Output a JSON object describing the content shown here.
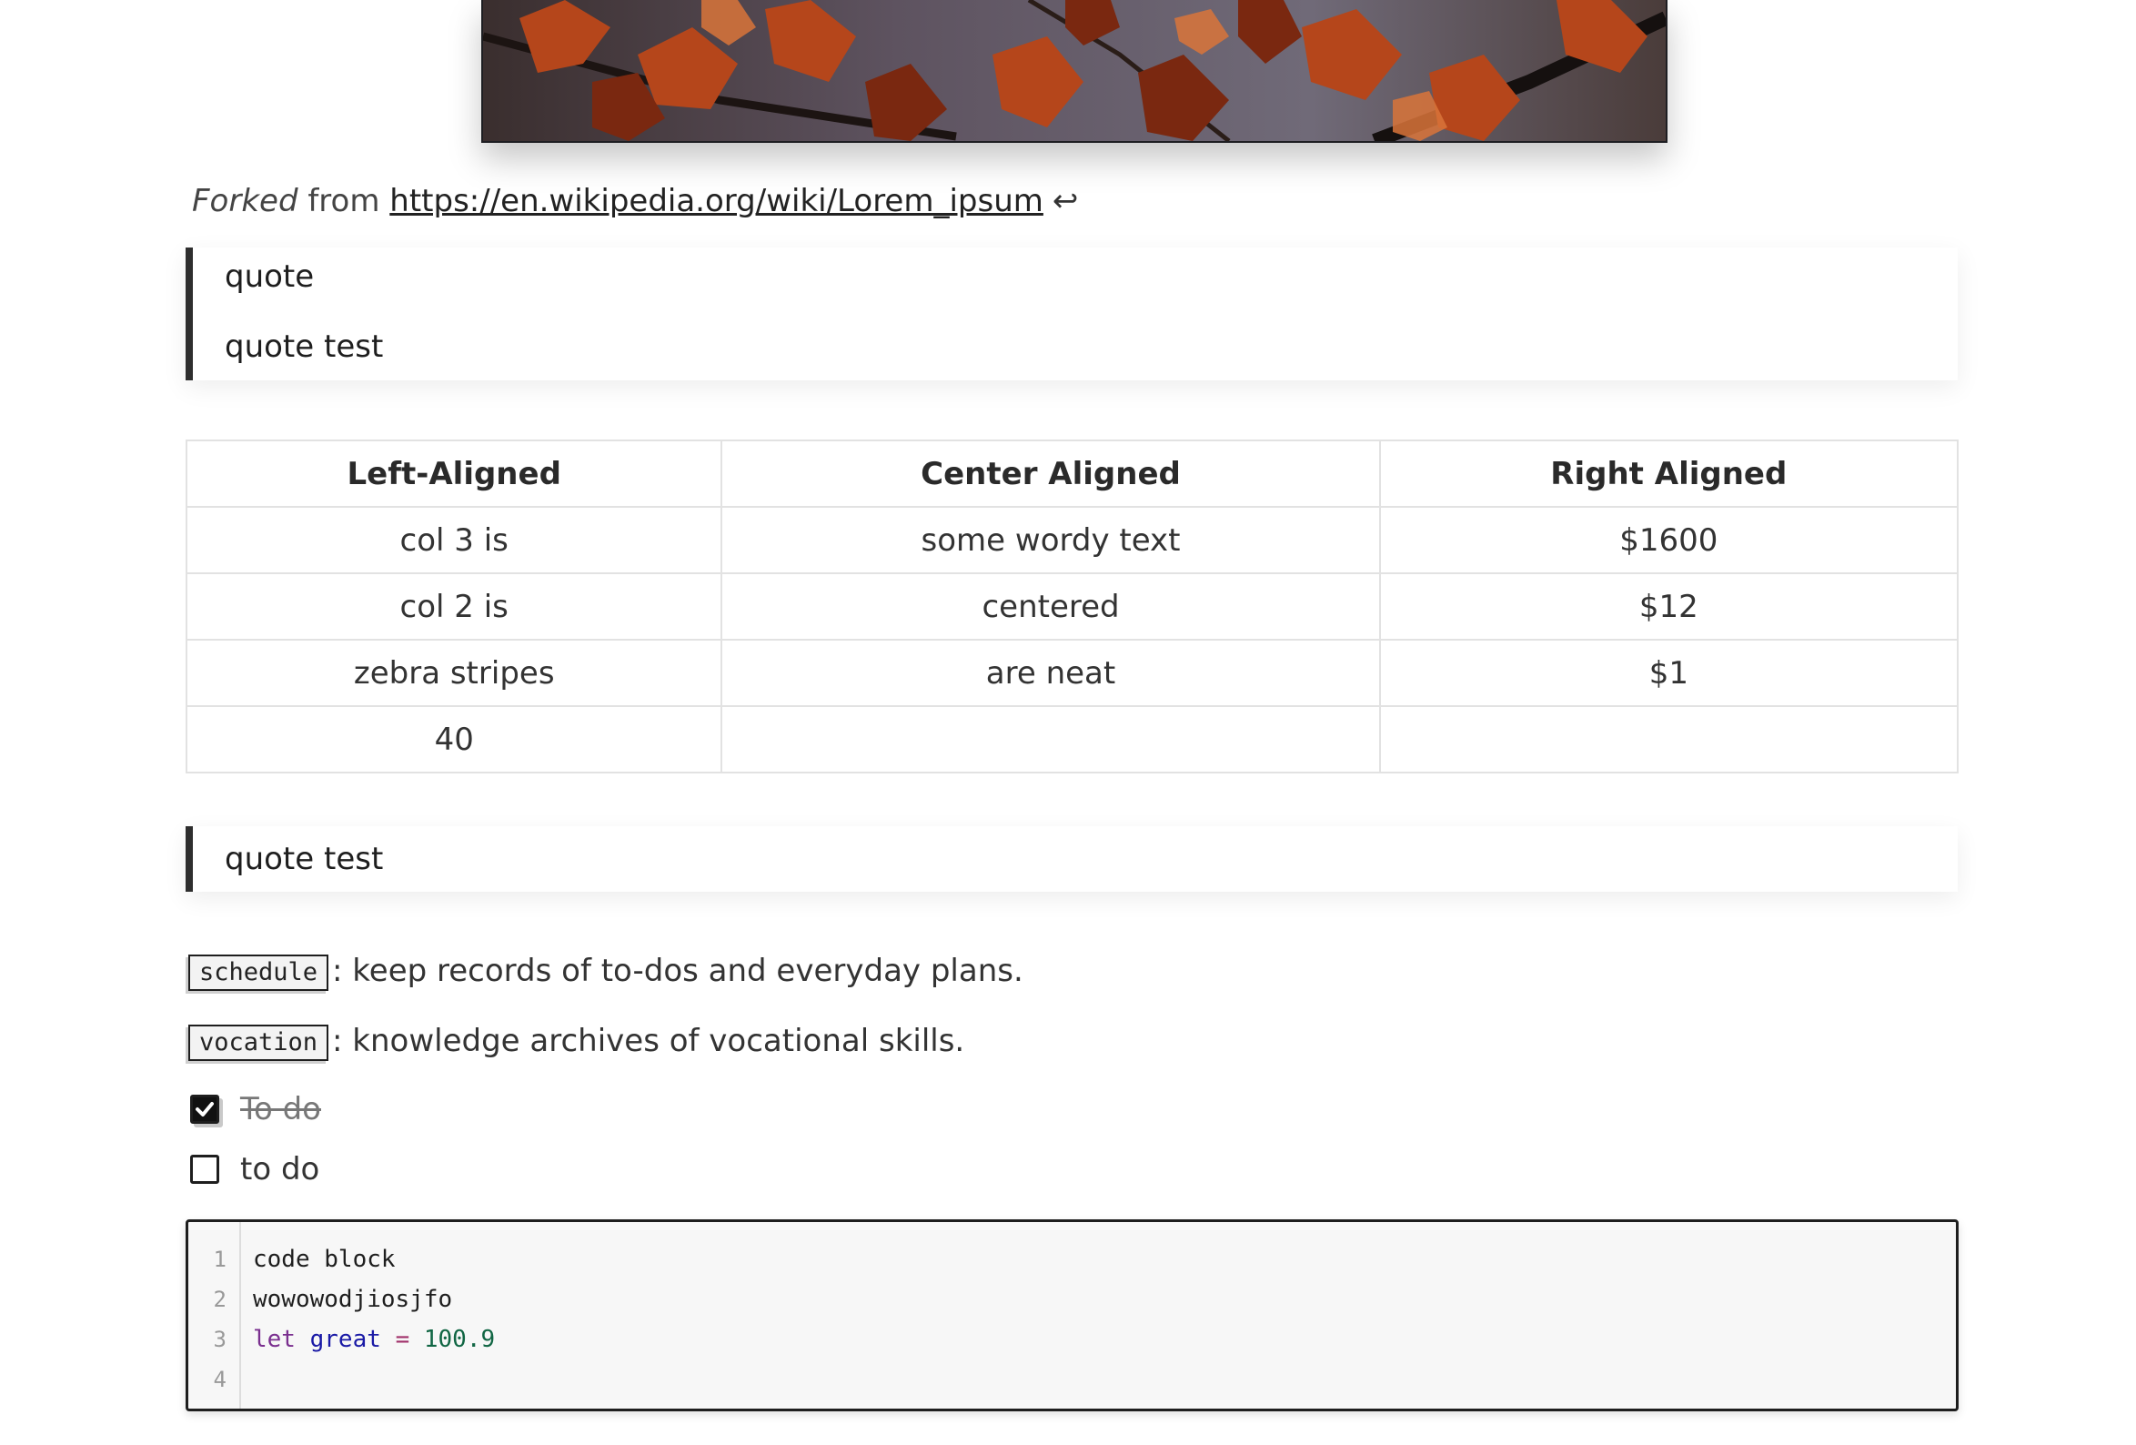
{
  "hero_image": {
    "alt_icon": "autumn-leaves-photo",
    "colors": [
      "#8a2e12",
      "#c4501e",
      "#6d6472"
    ]
  },
  "footnote": {
    "em_text": "Forked",
    "mid_text": " from ",
    "link_text": "https://en.wikipedia.org/wiki/Lorem_ipsum",
    "backref": "↩"
  },
  "blockquote1": {
    "line1": "quote",
    "line2": "quote test"
  },
  "table": {
    "headers": [
      "Left-Aligned",
      "Center Aligned",
      "Right Aligned"
    ],
    "rows": [
      [
        "col 3 is",
        "some wordy text",
        "$1600"
      ],
      [
        "col 2 is",
        "centered",
        "$12"
      ],
      [
        "zebra stripes",
        "are neat",
        "$1"
      ],
      [
        "40",
        "",
        ""
      ]
    ]
  },
  "blockquote2": {
    "line1": "quote test"
  },
  "tags": [
    {
      "tag": "schedule",
      "desc": ": keep records of to-dos and everyday plans."
    },
    {
      "tag": "vocation",
      "desc": ": knowledge archives of vocational skills."
    }
  ],
  "tasks": [
    {
      "label": "To do",
      "checked": true
    },
    {
      "label": "to do",
      "checked": false
    }
  ],
  "code": {
    "line_numbers": [
      "1",
      "2",
      "3",
      "4"
    ],
    "line1": "code block",
    "line2": "wowowodjiosjfo",
    "line3_kw": "let",
    "line3_var": "great",
    "line3_op": "=",
    "line3_num": "100.9",
    "line4": ""
  }
}
